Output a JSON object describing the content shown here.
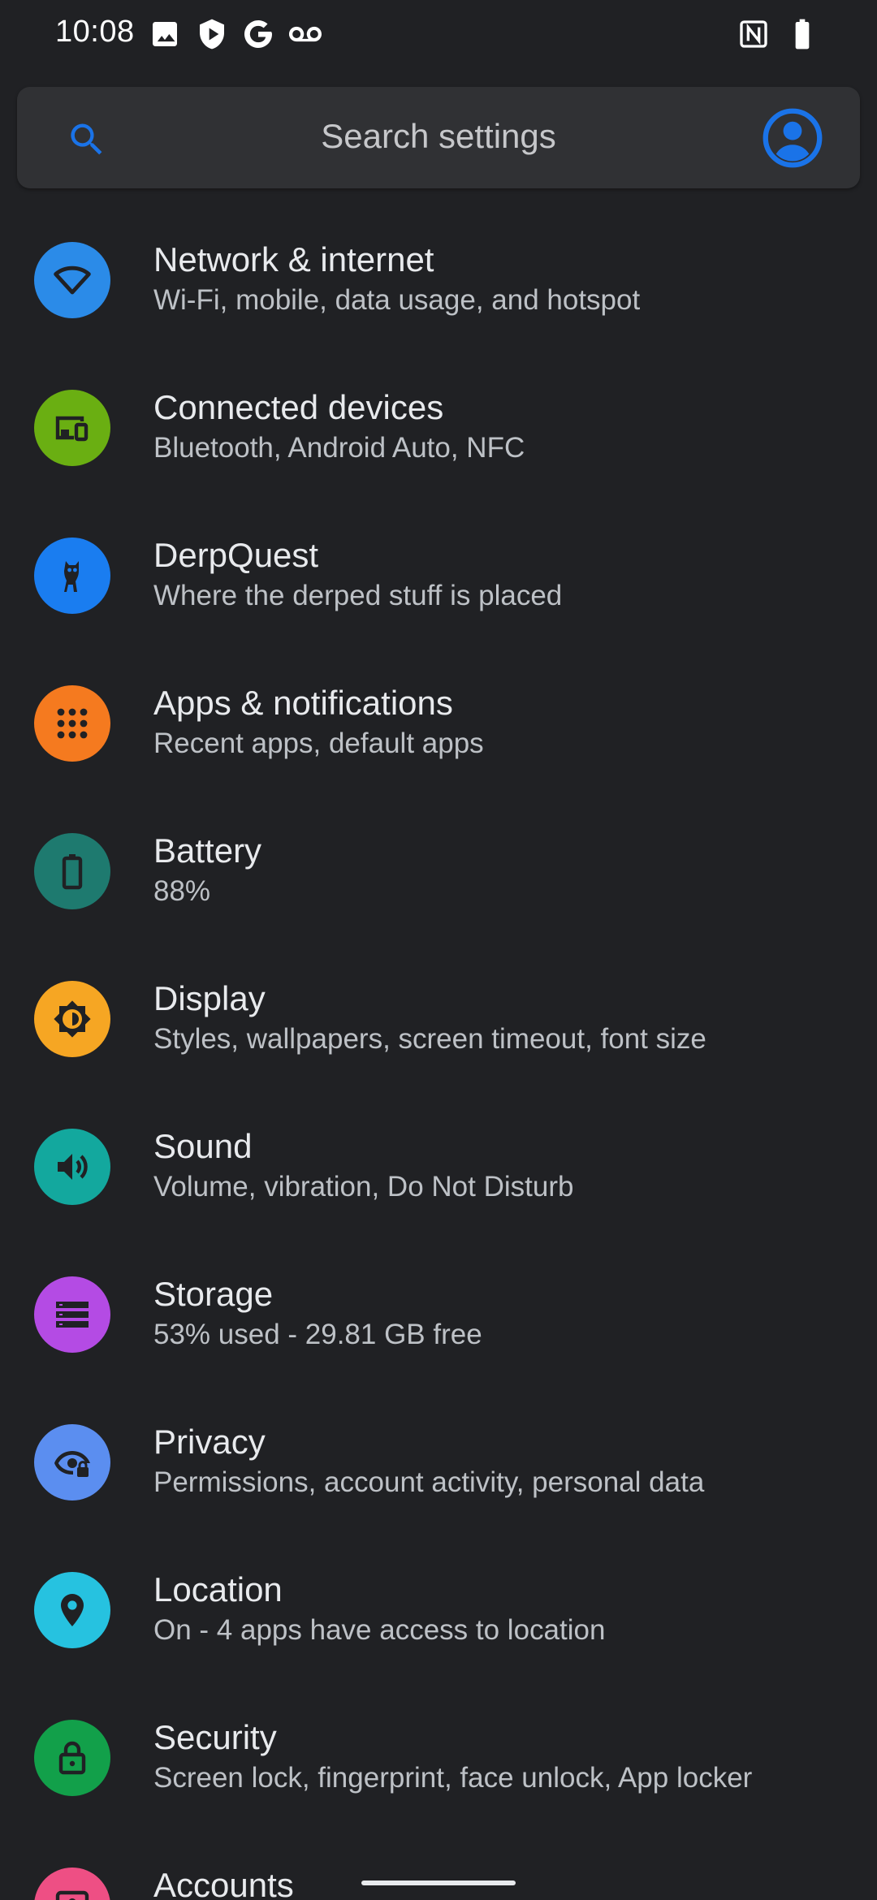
{
  "status_bar": {
    "time": "10:08",
    "icons": [
      "image-icon",
      "shield-play-icon",
      "google-icon",
      "voicemail-icon",
      "nfc-icon",
      "battery-icon"
    ]
  },
  "search": {
    "placeholder": "Search settings",
    "accent": "#1a73e8"
  },
  "settings": [
    {
      "title": "Network & internet",
      "summary": "Wi-Fi, mobile, data usage, and hotspot",
      "color": "#2b8be8",
      "icon": "wifi-icon"
    },
    {
      "title": "Connected devices",
      "summary": "Bluetooth, Android Auto, NFC",
      "color": "#6aaf12",
      "icon": "devices-icon"
    },
    {
      "title": "DerpQuest",
      "summary": "Where the derped stuff is placed",
      "color": "#1a7df0",
      "icon": "owl-icon"
    },
    {
      "title": "Apps & notifications",
      "summary": "Recent apps, default apps",
      "color": "#f57a1f",
      "icon": "apps-grid-icon"
    },
    {
      "title": "Battery",
      "summary": "88%",
      "color": "#1e7a6f",
      "icon": "battery-icon"
    },
    {
      "title": "Display",
      "summary": "Styles, wallpapers, screen timeout, font size",
      "color": "#f6a623",
      "icon": "brightness-icon"
    },
    {
      "title": "Sound",
      "summary": "Volume, vibration, Do Not Disturb",
      "color": "#13a89e",
      "icon": "volume-icon"
    },
    {
      "title": "Storage",
      "summary": "53% used - 29.81 GB free",
      "color": "#b44be4",
      "icon": "storage-icon"
    },
    {
      "title": "Privacy",
      "summary": "Permissions, account activity, personal data",
      "color": "#5b8ef0",
      "icon": "privacy-eye-icon"
    },
    {
      "title": "Location",
      "summary": "On - 4 apps have access to location",
      "color": "#26c2e0",
      "icon": "location-pin-icon"
    },
    {
      "title": "Security",
      "summary": "Screen lock, fingerprint, face unlock, App locker",
      "color": "#12a04a",
      "icon": "lock-icon"
    },
    {
      "title": "Accounts",
      "summary": "",
      "color": "#ee4f84",
      "icon": "account-icon"
    }
  ]
}
